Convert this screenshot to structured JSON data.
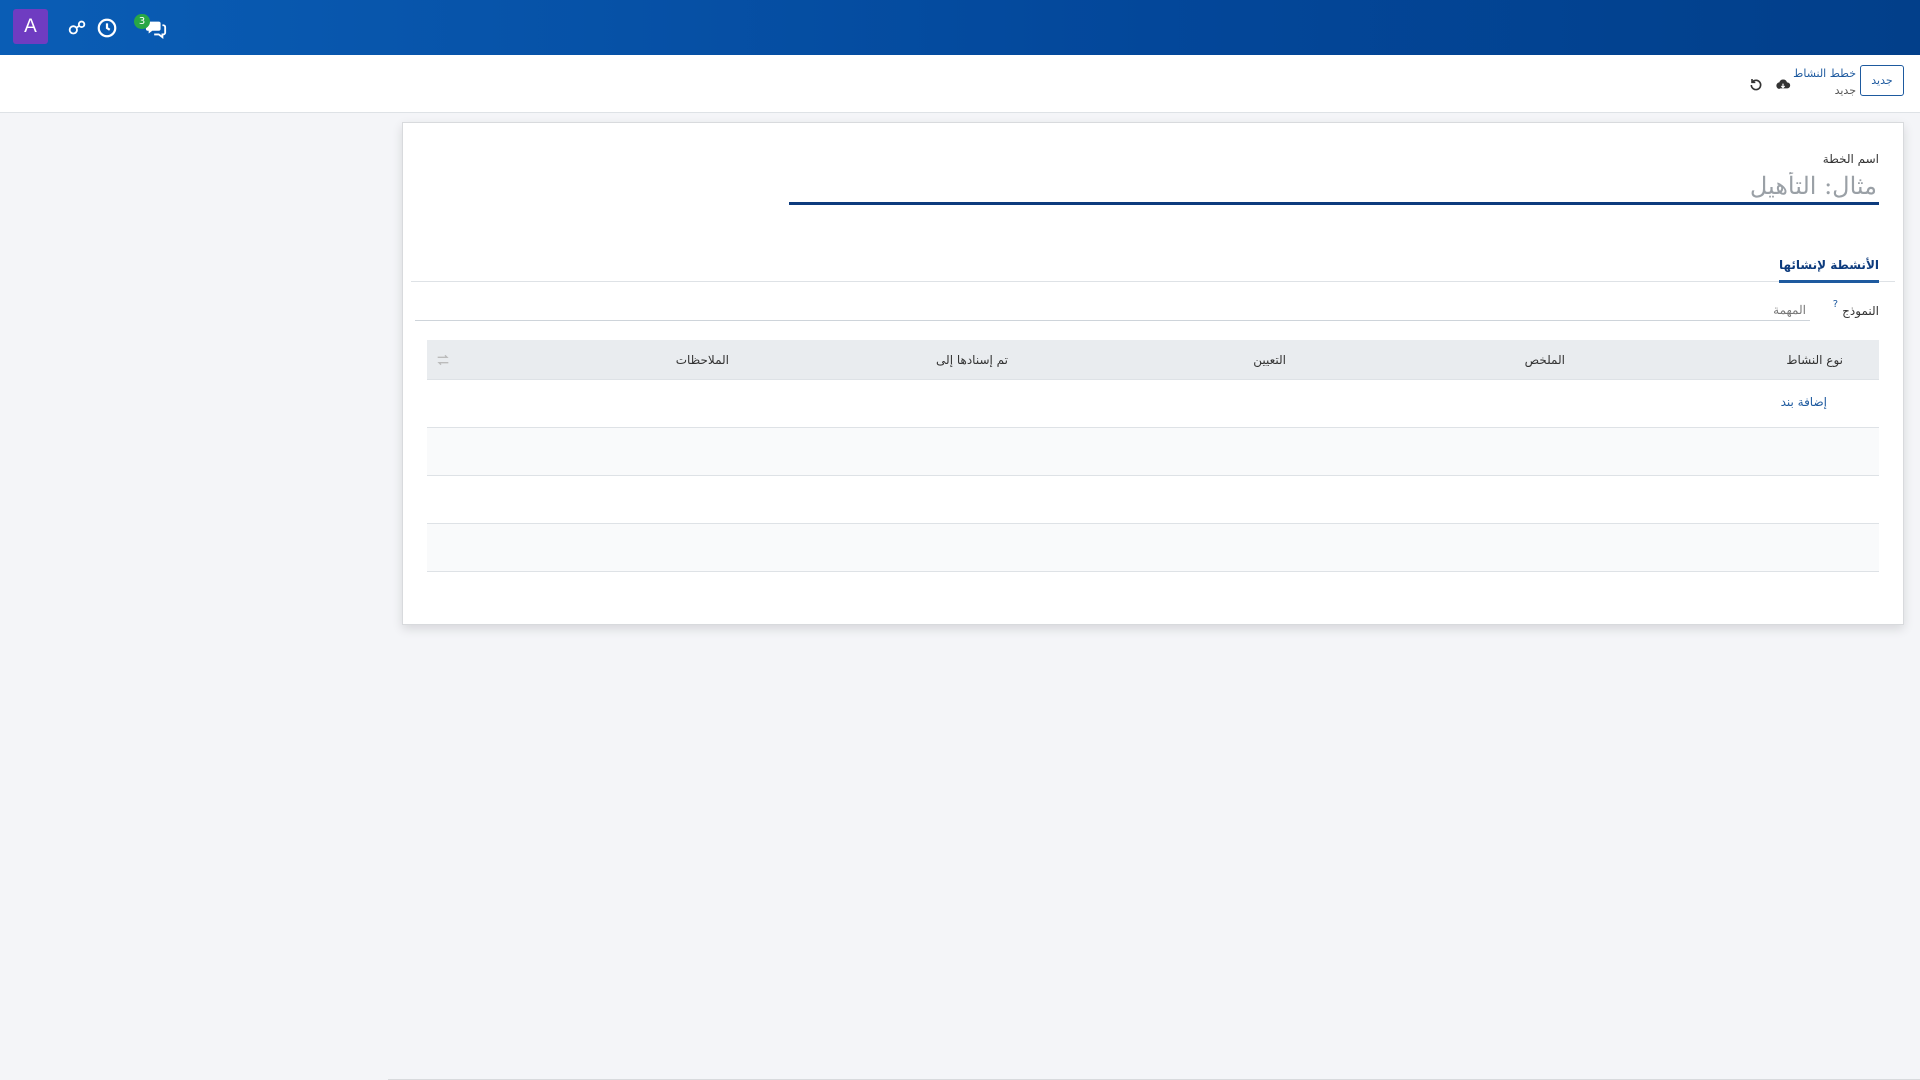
{
  "navbar": {
    "avatar_letter": "A",
    "icons": [
      "activity-icon",
      "clock-icon",
      "chat-icon"
    ],
    "chat_badge": "3"
  },
  "control_panel": {
    "new_button": "جديد",
    "breadcrumb_parent": "خطط النشاط",
    "breadcrumb_current": "جديد"
  },
  "form": {
    "name_label": "اسم الخطة",
    "name_placeholder": "مثال: التأهيل",
    "tab_activities": "الأنشطة لإنشائها",
    "template_label": "النموذج",
    "template_help": "?",
    "template_placeholder": "المهمة"
  },
  "table": {
    "columns": [
      "نوع النشاط",
      "الملخص",
      "التعيين",
      "تم إسنادها إلى",
      "الملاحظات"
    ],
    "add_line": "إضافة بند"
  },
  "colors": {
    "navbar": "#03479a",
    "accent": "#1e5a9f",
    "avatar": "#6f3cc1",
    "badge": "#28a745"
  }
}
